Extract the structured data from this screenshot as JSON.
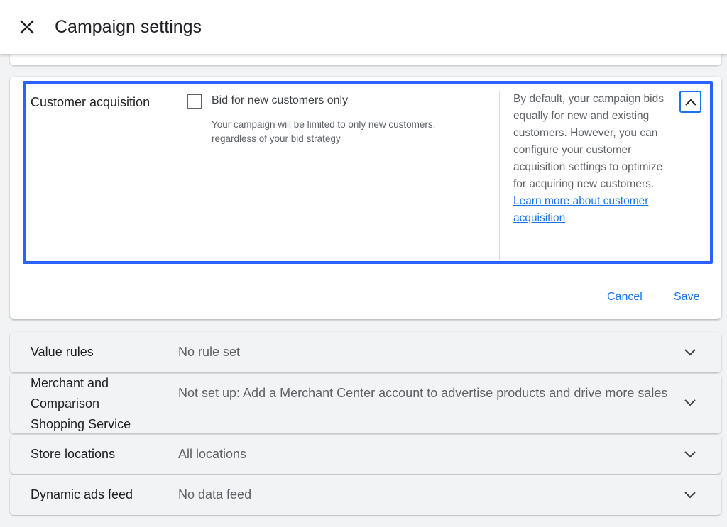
{
  "header": {
    "close_icon": "close-icon",
    "title": "Campaign settings"
  },
  "customer_acquisition": {
    "label": "Customer acquisition",
    "checkbox_label": "Bid for new customers only",
    "checkbox_checked": false,
    "checkbox_description": "Your campaign will be limited to only new customers, regardless of your bid strategy",
    "help_text": "By default, your campaign bids equally for new and existing customers. However, you can configure your customer acquisition settings to optimize for acquiring new customers.",
    "help_link": "Learn more about customer acquisition",
    "collapse_icon": "chevron-up-icon",
    "highlight_color": "#2962ff",
    "cancel_label": "Cancel",
    "save_label": "Save"
  },
  "rows": [
    {
      "title": "Value rules",
      "value": "No rule set"
    },
    {
      "title": "Merchant and Comparison Shopping Service",
      "value": "Not set up: Add a Merchant Center account to advertise products and drive more sales"
    },
    {
      "title": "Store locations",
      "value": "All locations"
    },
    {
      "title": "Dynamic ads feed",
      "value": "No data feed"
    }
  ],
  "colors": {
    "accent": "#1a73e8",
    "background": "#f1f3f4"
  }
}
